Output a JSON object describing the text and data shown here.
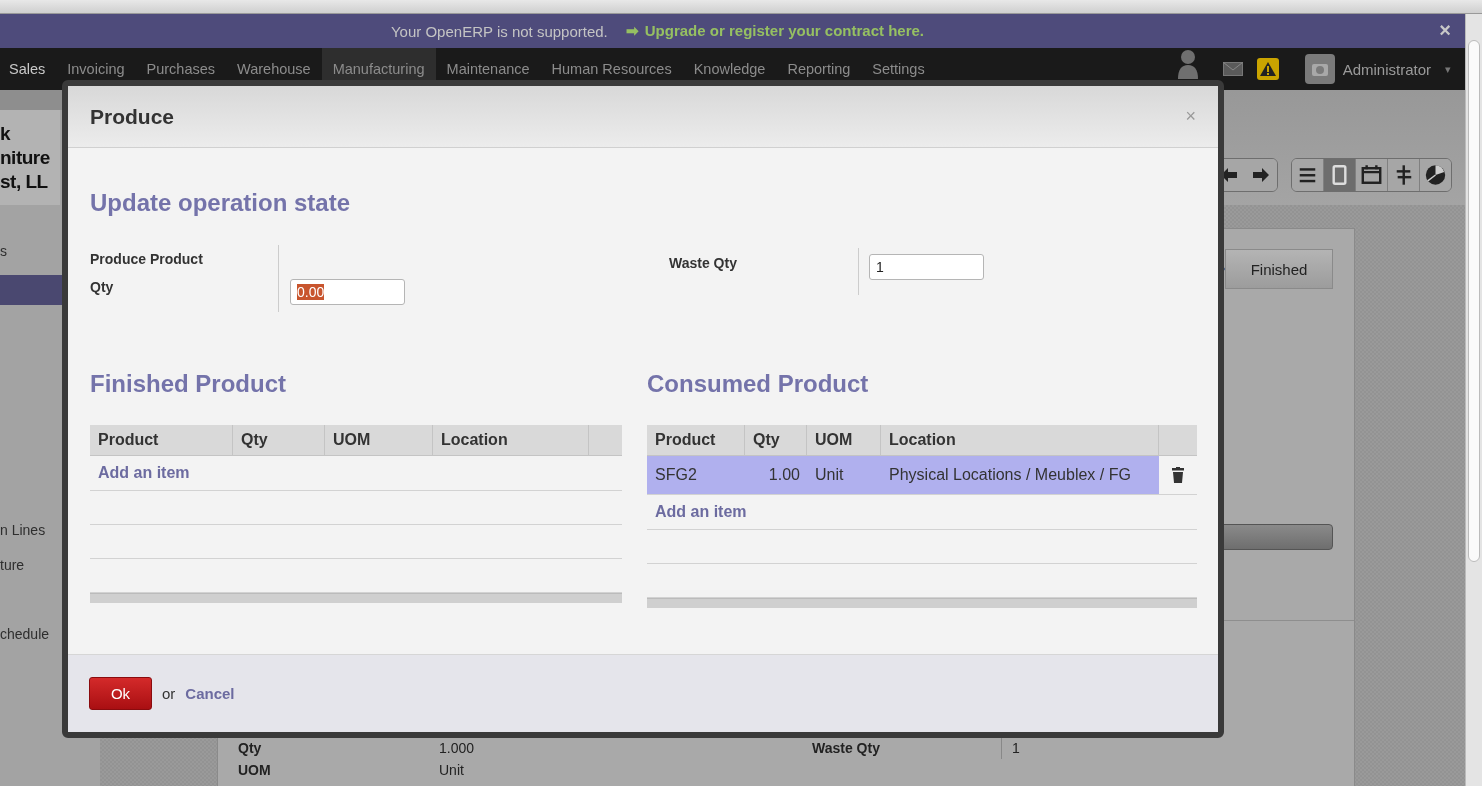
{
  "banner": {
    "message": "Your OpenERP is not supported.",
    "arrow": "➡",
    "link": "Upgrade or register your contract here.",
    "close": "×"
  },
  "menu": [
    {
      "label": "Sales",
      "selected": false
    },
    {
      "label": "Invoicing",
      "selected": false
    },
    {
      "label": "Purchases",
      "selected": false
    },
    {
      "label": "Warehouse",
      "selected": false
    },
    {
      "label": "Manufacturing",
      "selected": true
    },
    {
      "label": "Maintenance",
      "selected": false
    },
    {
      "label": "Human Resources",
      "selected": false
    },
    {
      "label": "Knowledge",
      "selected": false
    },
    {
      "label": "Reporting",
      "selected": false
    },
    {
      "label": "Settings",
      "selected": false
    }
  ],
  "user": {
    "name": "Administrator",
    "caret": "▾"
  },
  "sidebar": {
    "logo_lines": [
      "k",
      "niture",
      "st, LL"
    ],
    "items": [
      {
        "label": "s",
        "selected": false
      },
      {
        "selected": true
      },
      {
        "label": "n Lines",
        "selected": false
      },
      {
        "label": "ture",
        "selected": false
      },
      {
        "label": "chedule",
        "selected": false
      }
    ]
  },
  "views": [
    {
      "kind": "list",
      "selected": false
    },
    {
      "kind": "form",
      "selected": true
    },
    {
      "kind": "calendar",
      "selected": false
    },
    {
      "kind": "gantt",
      "selected": false
    },
    {
      "kind": "graph",
      "selected": false
    }
  ],
  "record": {
    "status": "Finished",
    "fields": [
      {
        "label": "Qty",
        "value": "1.000"
      },
      {
        "label": "Waste Qty",
        "value": "1"
      },
      {
        "label": "UOM",
        "value": "Unit"
      }
    ]
  },
  "dialog": {
    "title": "Produce",
    "close": "×",
    "heading": "Update operation state",
    "produce_qty": {
      "label": "Produce Product Qty",
      "value": "0.00",
      "selected": true
    },
    "waste_qty": {
      "label": "Waste Qty",
      "value": "1"
    },
    "finished": {
      "title": "Finished Product",
      "columns": [
        "Product",
        "Qty",
        "UOM",
        "Location"
      ],
      "add": "Add an item"
    },
    "consumed": {
      "title": "Consumed Product",
      "columns": [
        "Product",
        "Qty",
        "UOM",
        "Location"
      ],
      "rows": [
        {
          "product": "SFG2",
          "qty": "1.00",
          "uom": "Unit",
          "location": "Physical Locations / Meublex / FG",
          "selected": true
        }
      ],
      "add": "Add an item"
    },
    "ok": "Ok",
    "or": "or",
    "cancel": "Cancel"
  }
}
